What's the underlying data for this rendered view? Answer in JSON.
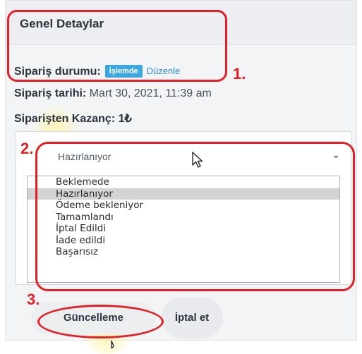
{
  "panel": {
    "title": "Genel Detaylar"
  },
  "order_status": {
    "label": "Sipariş durumu:",
    "badge": "İşlemde",
    "edit_link": "Düzenle"
  },
  "order_date": {
    "label": "Sipariş tarihi:",
    "value": "Mart 30, 2021, 11:39 am"
  },
  "earnings": {
    "label": "Siparişten Kazanç:",
    "value": "1₺"
  },
  "status_select": {
    "value": "Hazırlanıyor",
    "options": [
      "Beklemede",
      "Hazırlanıyor",
      "Ödeme bekleniyor",
      "Tamamlandı",
      "İptal Edildi",
      "İade edildi",
      "Başarısız"
    ],
    "selected_index": 1
  },
  "buttons": {
    "update": "Güncelleme",
    "cancel": "İptal et"
  },
  "annotations": {
    "n1": "1.",
    "n2": "2.",
    "n3": "3.",
    "color": "#e41f26"
  }
}
